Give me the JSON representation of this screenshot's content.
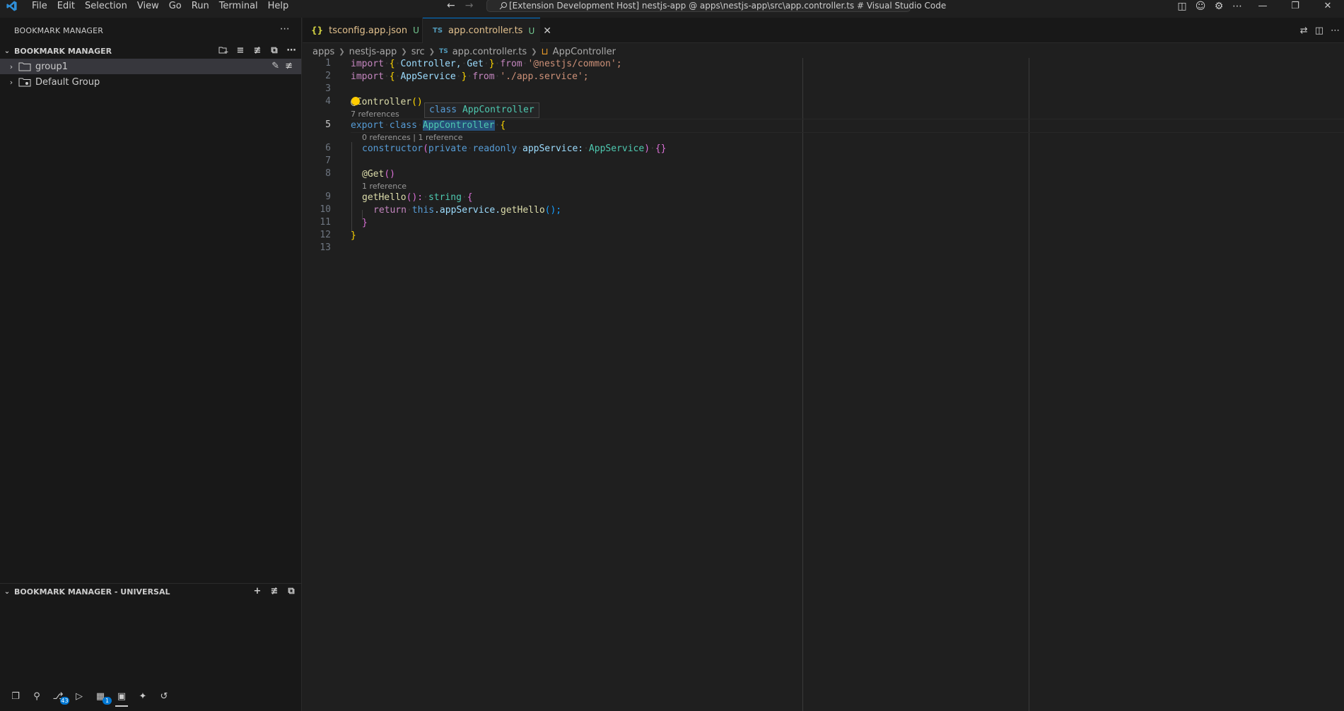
{
  "menu": [
    "File",
    "Edit",
    "Selection",
    "View",
    "Go",
    "Run",
    "Terminal",
    "Help"
  ],
  "command_center": "[Extension Development Host] nestjs-app @ apps\\nestjs-app\\src\\app.controller.ts # Visual Studio Code",
  "sidebar": {
    "title": "BOOKMARK MANAGER",
    "section1": "BOOKMARK MANAGER",
    "tree": [
      {
        "label": "group1",
        "selected": true
      },
      {
        "label": "Default Group",
        "selected": false
      }
    ],
    "section2": "BOOKMARK MANAGER - UNIVERSAL"
  },
  "activity_badges": {
    "scm": "43",
    "extensions": "1"
  },
  "tabs": [
    {
      "icon": "{}",
      "name": "tsconfig.app.json",
      "status": "U"
    },
    {
      "icon": "TS",
      "name": "app.controller.ts",
      "status": "U"
    }
  ],
  "breadcrumbs": [
    "apps",
    "nestjs-app",
    "src",
    "app.controller.ts",
    "AppController"
  ],
  "code": {
    "line_numbers": [
      "1",
      "2",
      "3",
      "4",
      "5",
      "6",
      "7",
      "8",
      "9",
      "10",
      "11",
      "12",
      "13"
    ],
    "lens_7": "7 references",
    "lens_0": "0 references | 1 reference",
    "lens_1": "1 reference",
    "hover": "class AppController",
    "l1": [
      "import",
      "{",
      "Controller,",
      "Get",
      "}",
      "from",
      "'@nestjs/common';"
    ],
    "l2": [
      "import",
      "{",
      "AppService",
      "}",
      "from",
      "'./app.service';"
    ],
    "l4": [
      "@Controller",
      "()"
    ],
    "l5": [
      "export",
      "class",
      "AppController",
      "{"
    ],
    "l6": [
      "constructor",
      "(",
      "private",
      "readonly",
      "appService:",
      "AppService",
      ")",
      "{}"
    ],
    "l8": [
      "@Get",
      "()"
    ],
    "l9": [
      "getHello",
      "():",
      "string",
      "{"
    ],
    "l10": [
      "return",
      "this",
      ".appService.",
      "getHello",
      "();"
    ],
    "l11": "}",
    "l12": "}"
  }
}
